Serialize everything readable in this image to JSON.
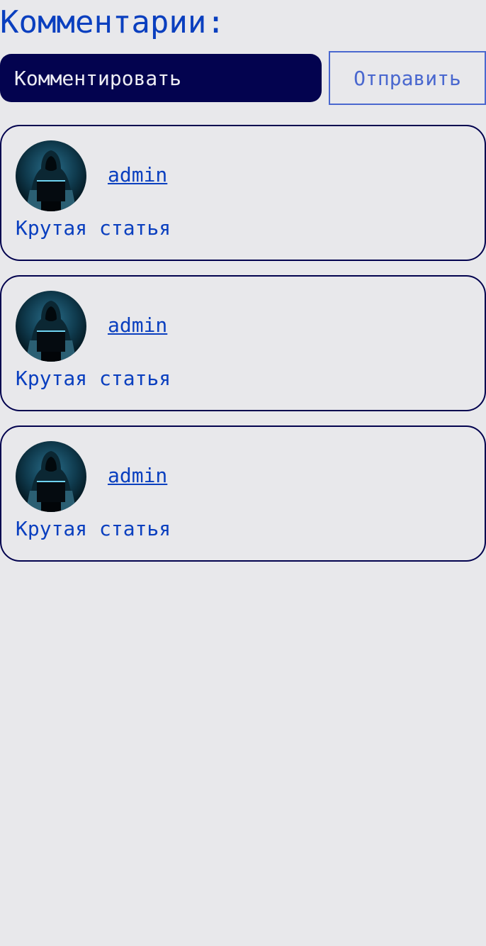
{
  "header": {
    "title": "Комментарии:"
  },
  "form": {
    "input_placeholder": "Комментировать",
    "send_label": "Отправить"
  },
  "comments": [
    {
      "author": "admin",
      "text": "Крутая статья",
      "avatar_icon": "hooded-hacker-avatar"
    },
    {
      "author": "admin",
      "text": "Крутая статья",
      "avatar_icon": "hooded-hacker-avatar"
    },
    {
      "author": "admin",
      "text": "Крутая статья",
      "avatar_icon": "hooded-hacker-avatar"
    }
  ],
  "colors": {
    "background": "#e8e8eb",
    "accent": "#0a3fbf",
    "input_bg": "#03034f",
    "button_border": "#4a68cf"
  }
}
